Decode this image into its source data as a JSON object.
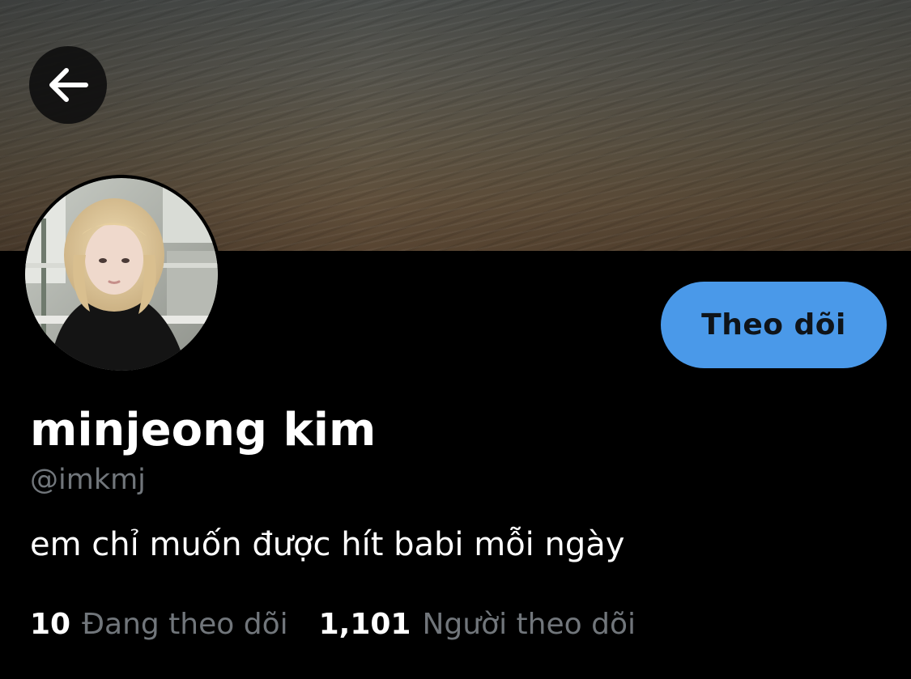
{
  "header": {
    "back_icon": "arrow-left-icon"
  },
  "profile": {
    "display_name": "minjeong kim",
    "handle": "@imkmj",
    "bio": "em chỉ muốn được hít babi mỗi ngày",
    "follow_button_label": "Theo dõi",
    "following_count": "10",
    "following_label": "Đang theo dõi",
    "followers_count": "1,101",
    "followers_label": "Người theo dõi"
  },
  "colors": {
    "background": "#000000",
    "accent": "#4a99e9",
    "secondary_text": "#71767b",
    "primary_text": "#ffffff"
  }
}
